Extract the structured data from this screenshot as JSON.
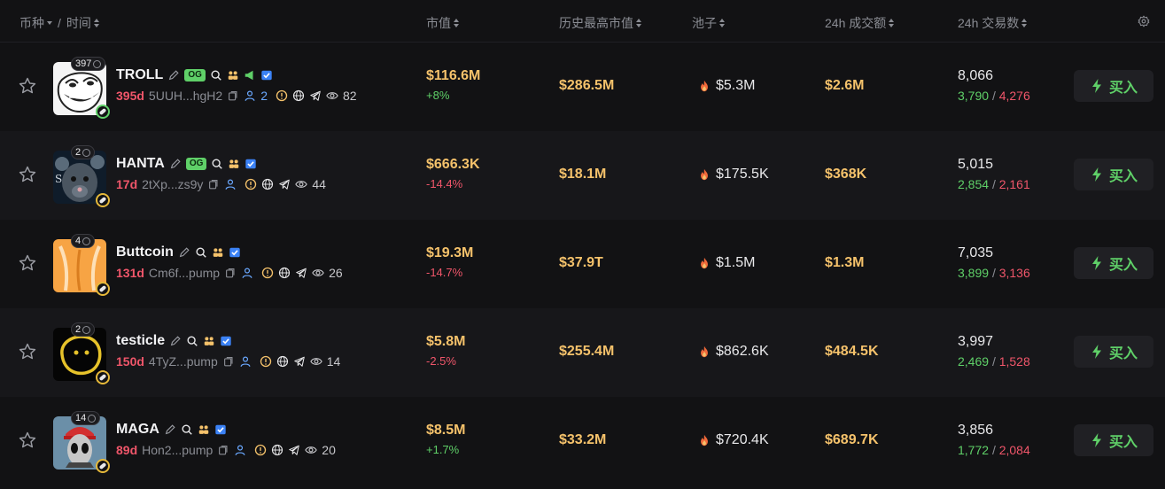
{
  "header": {
    "coin_label": "币种",
    "time_label": "时间",
    "mcap_label": "市值",
    "ath_label": "历史最高市值",
    "pool_label": "池子",
    "vol_label": "24h 成交额",
    "txns_label": "24h 交易数"
  },
  "colors": {
    "background": "#121214",
    "alt_row": "#17171a",
    "gold": "#f5c26b",
    "green": "#5fd068",
    "red": "#f0566a",
    "accent_blue": "#6aa8ff"
  },
  "buy_label": "买入",
  "rows": [
    {
      "count": "397",
      "name": "TROLL",
      "og": "OG",
      "age": "395d",
      "address": "5UUH...hgH2",
      "holders": "2",
      "views": "82",
      "mcap": "$116.6M",
      "change": "+8%",
      "ath": "$286.5M",
      "pool": "$5.3M",
      "volume": "$2.6M",
      "txns": "8,066",
      "buys": "3,790",
      "sells": "4,276"
    },
    {
      "count": "2",
      "name": "HANTA",
      "og": "OG",
      "age": "17d",
      "address": "2tXp...zs9y",
      "holders": "",
      "views": "44",
      "mcap": "$666.3K",
      "change": "-14.4%",
      "ath": "$18.1M",
      "pool": "$175.5K",
      "volume": "$368K",
      "txns": "5,015",
      "buys": "2,854",
      "sells": "2,161"
    },
    {
      "count": "4",
      "name": "Buttcoin",
      "og": "",
      "age": "131d",
      "address": "Cm6f...pump",
      "holders": "",
      "views": "26",
      "mcap": "$19.3M",
      "change": "-14.7%",
      "ath": "$37.9T",
      "pool": "$1.5M",
      "volume": "$1.3M",
      "txns": "7,035",
      "buys": "3,899",
      "sells": "3,136"
    },
    {
      "count": "2",
      "name": "testicle",
      "og": "",
      "age": "150d",
      "address": "4TyZ...pump",
      "holders": "",
      "views": "14",
      "mcap": "$5.8M",
      "change": "-2.5%",
      "ath": "$255.4M",
      "pool": "$862.6K",
      "volume": "$484.5K",
      "txns": "3,997",
      "buys": "2,469",
      "sells": "1,528"
    },
    {
      "count": "14",
      "name": "MAGA",
      "og": "",
      "age": "89d",
      "address": "Hon2...pump",
      "holders": "",
      "views": "20",
      "mcap": "$8.5M",
      "change": "+1.7%",
      "ath": "$33.2M",
      "pool": "$720.4K",
      "volume": "$689.7K",
      "txns": "3,856",
      "buys": "1,772",
      "sells": "2,084"
    }
  ]
}
